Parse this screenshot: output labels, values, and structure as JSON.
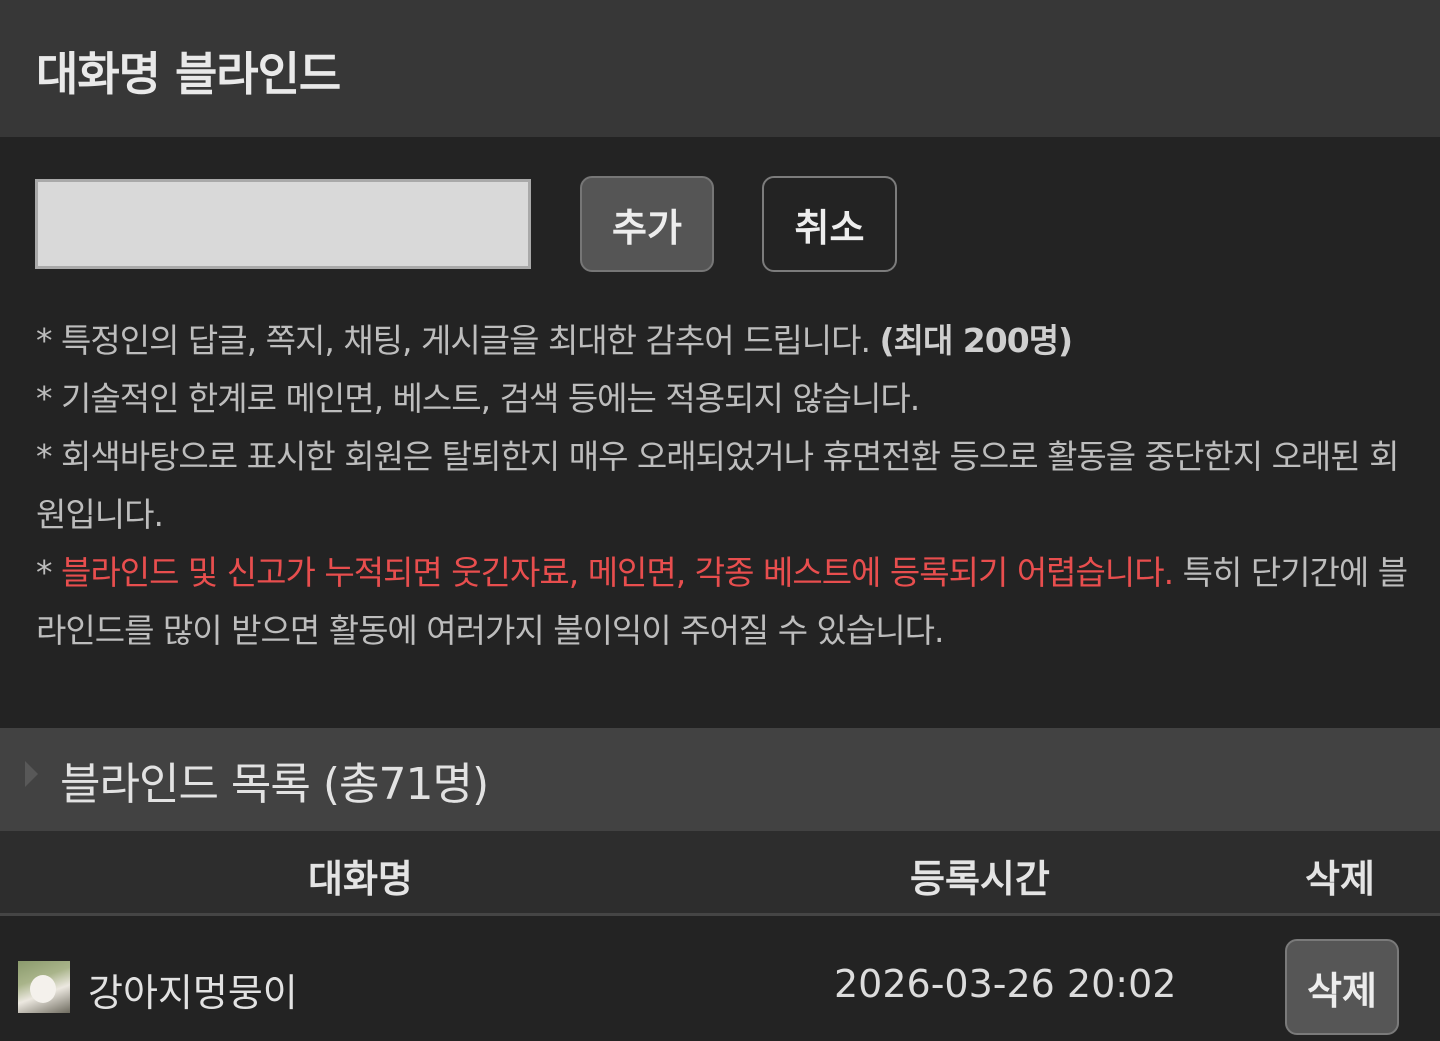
{
  "header": {
    "title": "대화명 블라인드"
  },
  "form": {
    "input_value": "",
    "add_label": "추가",
    "cancel_label": "취소"
  },
  "notes": {
    "n1_text": "* 특정인의 답글, 쪽지, 채팅, 게시글을 최대한 감추어 드립니다. ",
    "n1_bold": "(최대 200명)",
    "n2": "* 기술적인 한계로 메인면, 베스트, 검색 등에는 적용되지 않습니다.",
    "n3": "* 회색바탕으로 표시한 회원은 탈퇴한지 매우 오래되었거나 휴면전환 등으로 활동을 중단한지 오래된 회원입니다.",
    "n4_prefix": "* ",
    "n4_red": "블라인드 및 신고가 누적되면 웃긴자료, 메인면, 각종 베스트에 등록되기 어렵습니다.",
    "n4_rest": " 특히 단기간에 블라인드를 많이 받으면 활동에 여러가지 불이익이 주어질 수 있습니다.",
    "red_color": "#e84e4e"
  },
  "list": {
    "title": "블라인드 목록 (총71명)",
    "columns": {
      "name": "대화명",
      "time": "등록시간",
      "delete": "삭제"
    },
    "rows": [
      {
        "name": "강아지멍뭉이",
        "time": "2026-03-26 20:02",
        "delete_label": "삭제"
      }
    ]
  }
}
